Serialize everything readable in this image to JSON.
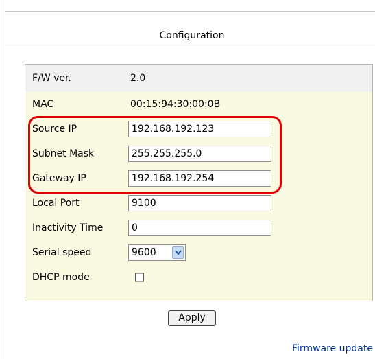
{
  "page": {
    "title": "Configuration"
  },
  "config": {
    "fw_version": {
      "label": "F/W ver.",
      "value": "2.0"
    },
    "mac": {
      "label": "MAC",
      "value": "00:15:94:30:00:0B"
    },
    "source_ip": {
      "label": "Source IP",
      "value": "192.168.192.123"
    },
    "subnet_mask": {
      "label": "Subnet Mask",
      "value": "255.255.255.0"
    },
    "gateway_ip": {
      "label": "Gateway IP",
      "value": "192.168.192.254"
    },
    "local_port": {
      "label": "Local Port",
      "value": "9100"
    },
    "inactivity_time": {
      "label": "Inactivity Time",
      "value": "0"
    },
    "serial_speed": {
      "label": "Serial speed",
      "value": "9600"
    },
    "dhcp_mode": {
      "label": "DHCP mode",
      "checked": false
    }
  },
  "actions": {
    "apply_label": "Apply",
    "firmware_link": "Firmware update"
  },
  "colors": {
    "panel_bg": "#fafae3",
    "highlight": "#e00000",
    "link": "#003399"
  }
}
